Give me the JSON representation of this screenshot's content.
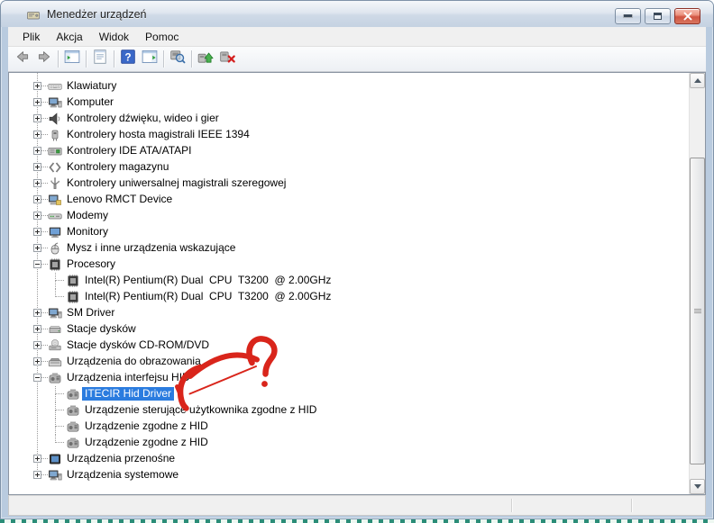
{
  "window": {
    "title": "Menedżer urządzeń",
    "controls": [
      {
        "name": "minimize-button"
      },
      {
        "name": "maximize-button"
      },
      {
        "name": "close-button"
      }
    ]
  },
  "menu": {
    "items": [
      "Plik",
      "Akcja",
      "Widok",
      "Pomoc"
    ]
  },
  "toolbar": {
    "groups": [
      [
        "back-icon",
        "forward-icon"
      ],
      [
        "show-console-tree-icon"
      ],
      [
        "properties-icon"
      ],
      [
        "help-icon",
        "show-action-pane-icon"
      ],
      [
        "scan-hardware-changes-icon"
      ],
      [
        "update-driver-icon",
        "uninstall-device-icon"
      ]
    ]
  },
  "tree": {
    "items": [
      {
        "label": "Klawiatury",
        "level": 1,
        "expand": "plus",
        "icon": "keyboard-icon"
      },
      {
        "label": "Komputer",
        "level": 1,
        "expand": "plus",
        "icon": "computer-icon"
      },
      {
        "label": "Kontrolery dźwięku, wideo i gier",
        "level": 1,
        "expand": "plus",
        "icon": "speaker-icon"
      },
      {
        "label": "Kontrolery hosta magistrali IEEE 1394",
        "level": 1,
        "expand": "plus",
        "icon": "firewire-icon"
      },
      {
        "label": "Kontrolery IDE ATA/ATAPI",
        "level": 1,
        "expand": "plus",
        "icon": "ide-controller-icon"
      },
      {
        "label": "Kontrolery magazynu",
        "level": 1,
        "expand": "plus",
        "icon": "storage-controller-icon"
      },
      {
        "label": "Kontrolery uniwersalnej magistrali szeregowej",
        "level": 1,
        "expand": "plus",
        "icon": "usb-icon"
      },
      {
        "label": "Lenovo RMCT Device",
        "level": 1,
        "expand": "plus",
        "icon": "computer-device-icon"
      },
      {
        "label": "Modemy",
        "level": 1,
        "expand": "plus",
        "icon": "modem-icon"
      },
      {
        "label": "Monitory",
        "level": 1,
        "expand": "plus",
        "icon": "monitor-icon"
      },
      {
        "label": "Mysz i inne urządzenia wskazujące",
        "level": 1,
        "expand": "plus",
        "icon": "mouse-icon"
      },
      {
        "label": "Procesory",
        "level": 1,
        "expand": "minus",
        "icon": "processor-icon"
      },
      {
        "label": "Intel(R) Pentium(R) Dual  CPU  T3200  @ 2.00GHz",
        "level": 2,
        "icon": "processor-icon",
        "last": false
      },
      {
        "label": "Intel(R) Pentium(R) Dual  CPU  T3200  @ 2.00GHz",
        "level": 2,
        "icon": "processor-icon",
        "last": true
      },
      {
        "label": "SM Driver",
        "level": 1,
        "expand": "plus",
        "icon": "computer-icon"
      },
      {
        "label": "Stacje dysków",
        "level": 1,
        "expand": "plus",
        "icon": "disk-drive-icon"
      },
      {
        "label": "Stacje dysków CD-ROM/DVD",
        "level": 1,
        "expand": "plus",
        "icon": "cdrom-icon"
      },
      {
        "label": "Urządzenia do obrazowania",
        "level": 1,
        "expand": "plus",
        "icon": "imaging-device-icon"
      },
      {
        "label": "Urządzenia interfejsu HID",
        "level": 1,
        "expand": "minus",
        "icon": "hid-icon"
      },
      {
        "label": "ITECIR Hid Driver",
        "level": 2,
        "icon": "hid-icon",
        "selected": true,
        "last": false
      },
      {
        "label": "Urządzenie sterujące użytkownika zgodne z HID",
        "level": 2,
        "icon": "hid-icon",
        "last": false
      },
      {
        "label": "Urządzenie zgodne z HID",
        "level": 2,
        "icon": "hid-icon",
        "last": false
      },
      {
        "label": "Urządzenie zgodne z HID",
        "level": 2,
        "icon": "hid-icon",
        "last": true
      },
      {
        "label": "Urządzenia przenośne",
        "level": 1,
        "expand": "plus",
        "icon": "portable-device-icon"
      },
      {
        "label": "Urządzenia systemowe",
        "level": 1,
        "expand": "plus",
        "icon": "computer-icon"
      }
    ]
  },
  "annotation": {
    "shapes": [
      "question-mark",
      "curved-arrow"
    ],
    "color": "#d9251b",
    "points_to": "ITECIR Hid Driver"
  },
  "colors": {
    "selection": "#2b7cdf",
    "help_blue": "#3a68c8",
    "close_red": "#d05441",
    "frame": "#b9cbdf"
  }
}
